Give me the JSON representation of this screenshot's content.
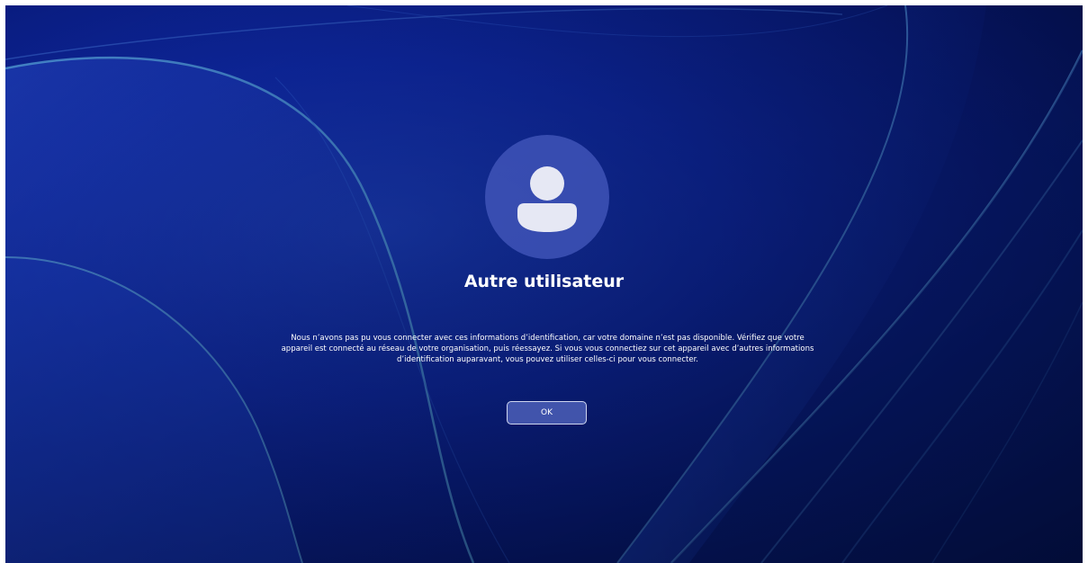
{
  "user": {
    "name": "Autre utilisateur",
    "avatar_icon": "person-icon"
  },
  "dialog": {
    "message": "Nous n’avons pas pu vous connecter avec ces informations d’identification, car votre domaine n’est pas disponible. Vérifiez que votre appareil est connecté au réseau de votre organisation, puis réessayez. Si vous vous connectiez sur cet appareil avec d’autres informations d’identification auparavant, vous pouvez utiliser celles-ci pour vous connecter.",
    "ok_label": "OK"
  },
  "colors": {
    "wallpaper_primary": "#0e27a0",
    "wallpaper_dark": "#040c45",
    "ribbon_highlight": "#4f8fd8",
    "avatar_circle": "#465abe",
    "avatar_glyph": "#e6e8f4"
  }
}
